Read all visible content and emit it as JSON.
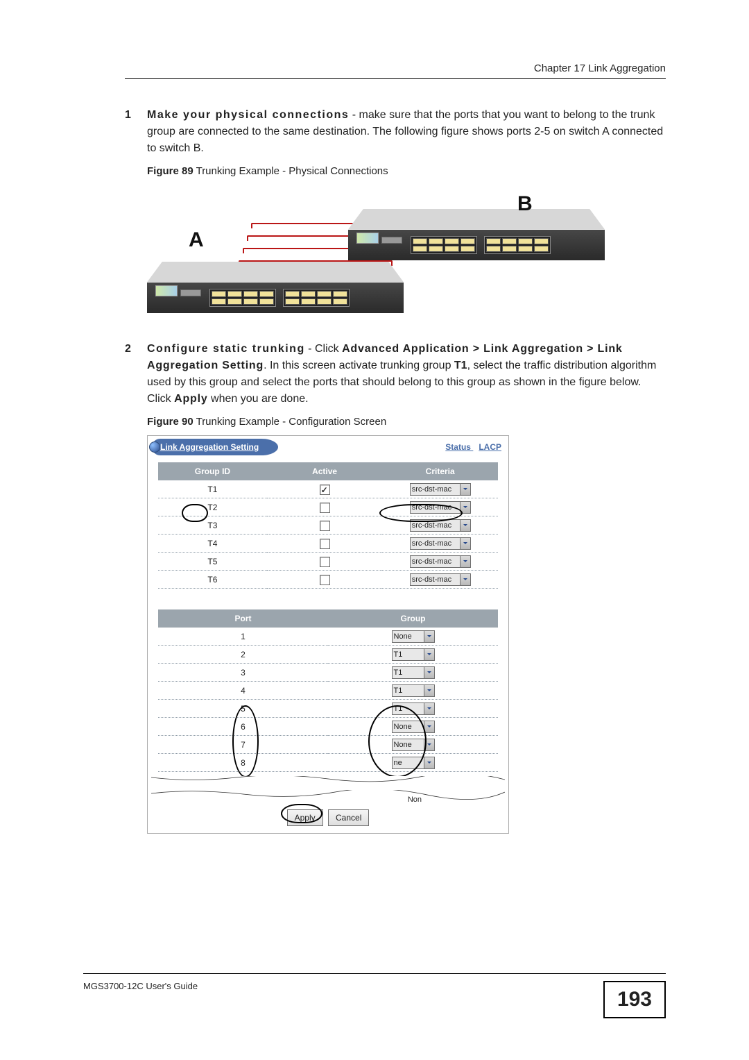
{
  "header": {
    "chapter": "Chapter 17 Link Aggregation"
  },
  "steps": {
    "s1": {
      "lead": "Make your physical connections",
      "body": " - make sure that the ports that you want to belong to the trunk group are connected to the same destination. The following figure shows ports 2-5 on switch A connected to switch B."
    },
    "s2": {
      "lead": "Configure static trunking",
      "mid": " - Click ",
      "nav": "Advanced Application > Link Aggregation > Link Aggregation Setting",
      "mid2": ". In this screen activate trunking group ",
      "grp": "T1",
      "mid3": ", select the traffic distribution algorithm used by this group and select the ports that should belong to this group as shown in the figure below. Click ",
      "apply": "Apply",
      "tail": " when you are done."
    }
  },
  "fig89": {
    "caption_no": "Figure 89",
    "caption": "   Trunking Example - Physical Connections",
    "labelA": "A",
    "labelB": "B"
  },
  "fig90": {
    "caption_no": "Figure 90",
    "caption": "   Trunking Example - Configuration Screen",
    "panel_title": "Link Aggregation Setting",
    "link_status": "Status",
    "link_lacp": "LACP",
    "th_group": "Group ID",
    "th_active": "Active",
    "th_criteria": "Criteria",
    "groups": [
      {
        "id": "T1",
        "active": true,
        "criteria": "src-dst-mac"
      },
      {
        "id": "T2",
        "active": false,
        "criteria": "src-dst-mac"
      },
      {
        "id": "T3",
        "active": false,
        "criteria": "src-dst-mac"
      },
      {
        "id": "T4",
        "active": false,
        "criteria": "src-dst-mac"
      },
      {
        "id": "T5",
        "active": false,
        "criteria": "src-dst-mac"
      },
      {
        "id": "T6",
        "active": false,
        "criteria": "src-dst-mac"
      }
    ],
    "th_port": "Port",
    "th_pgroup": "Group",
    "ports": [
      {
        "port": "1",
        "group": "None"
      },
      {
        "port": "2",
        "group": "T1"
      },
      {
        "port": "3",
        "group": "T1"
      },
      {
        "port": "4",
        "group": "T1"
      },
      {
        "port": "5",
        "group": "T1"
      },
      {
        "port": "6",
        "group": "None"
      },
      {
        "port": "7",
        "group": "None"
      },
      {
        "port": "8",
        "group": "ne"
      }
    ],
    "torn_label": "Non",
    "btn_apply": "Apply",
    "btn_cancel": "Cancel"
  },
  "footer": {
    "guide": "MGS3700-12C User's Guide",
    "page": "193"
  }
}
